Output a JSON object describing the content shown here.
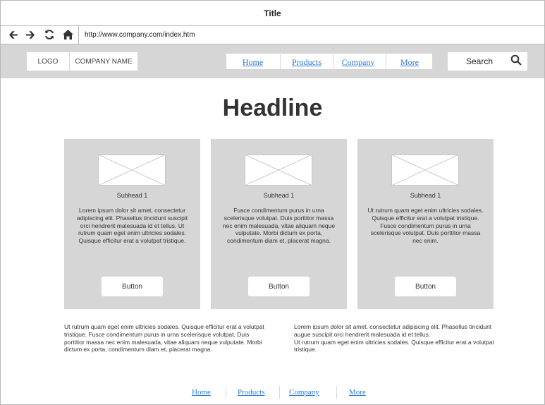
{
  "window": {
    "title": "Title"
  },
  "browser": {
    "url": "http://www.company.com/index.htm",
    "icons": [
      "back-arrow-icon",
      "forward-arrow-icon",
      "refresh-icon",
      "home-icon"
    ]
  },
  "header": {
    "logo": "LOGO",
    "company_name": "COMPANY NAME",
    "nav": [
      "Home",
      "Products",
      "Company",
      "More"
    ],
    "search_label": "Search"
  },
  "main": {
    "headline": "Headline",
    "cards": [
      {
        "subhead": "Subhead 1",
        "text": "Lorem ipsum dolor sit amet, consectetur adipiscing elit. Phasellus tincidunt suscipit orci hendrerit malesuada id et tellus. Ut rutrum quam eget enim ultricies sodales. Quisque efficitur erat a volutpat tristique.",
        "button": "Button"
      },
      {
        "subhead": "Subhead 1",
        "text": "Fusce condimentum purus in urna scelerisque volutpat. Duis porttitor massa nec enim malesuada, vitae aliquam neque vulputate. Morbi dictum ex porta, condimentum diam et, placerat magna.",
        "button": "Button"
      },
      {
        "subhead": "Subhead 1",
        "text": "Ut rutrum quam eget enim ultricies sodales. Quisque efficitur erat a volutpat tristique. Fusce condimentum purus in urna scelerisque volutpat. Duis porttitor massa nec enim.",
        "button": "Button"
      }
    ],
    "paragraphs": [
      "Ut rutrum quam eget enim ultricies sodales. Quisque efficitur erat a volutpat tristique. Fusce condimentum purus in urna scelerisque volutpat. Duis porttitor massa nec enim malesuada, vitae aliquam neque vulputate. Morbi dictum ex porta, condimentum diam et, placerat magna.",
      "Lorem ipsum dolor sit amet, consectetur adipiscing elit. Phasellus tincidunt augue suscipit orci hendrerit malesuada id et tellus.\nUt rutrum quam eget enim ultricies sodales. Quisque efficitur erat a volutpat tristique."
    ]
  },
  "footer": {
    "nav": [
      "Home",
      "Products",
      "Company",
      "More"
    ]
  },
  "colors": {
    "link": "#2b78d4",
    "band": "#d6d6d6",
    "border": "#b8b8b8"
  }
}
